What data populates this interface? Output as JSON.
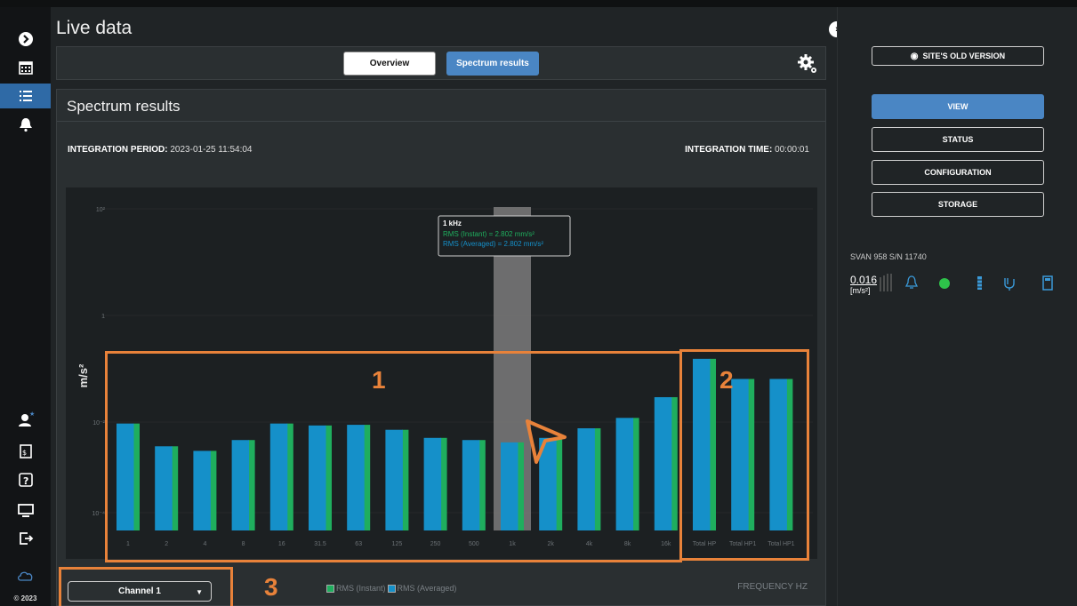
{
  "header": {
    "title": "Live data"
  },
  "tabs": [
    {
      "label": "Overview"
    },
    {
      "label": "Spectrum results"
    }
  ],
  "panel": {
    "title": "Spectrum results",
    "integration_period_label": "INTEGRATION PERIOD:",
    "integration_period_value": "2023-01-25 11:54:04",
    "integration_time_label": "INTEGRATION TIME:",
    "integration_time_value": "00:00:01"
  },
  "channel_select": {
    "value": "Channel 1"
  },
  "legend": {
    "instant": "RMS (Instant)",
    "averaged": "RMS (Averaged)"
  },
  "frequency_label": "FREQUENCY HZ",
  "annotations": [
    "1",
    "2",
    "3"
  ],
  "colors": {
    "accent": "#4a86c4",
    "instant": "#1fae5e",
    "averaged": "#1590c9",
    "annotation": "#e8823a"
  },
  "right_panel": {
    "old_version_label": "SITE'S OLD VERSION",
    "buttons": [
      "VIEW",
      "STATUS",
      "CONFIGURATION",
      "STORAGE"
    ],
    "device_name": "SVAN 958 S/N 11740",
    "device_value": "0.016",
    "device_unit": "[m/s²]"
  },
  "footer": {
    "copyright": "© 2023"
  },
  "chart_data": {
    "type": "bar",
    "ylabel": "m/s²",
    "xlabel": "FREQUENCY HZ",
    "yscale": "log",
    "ylim": [
      0.0001,
      10
    ],
    "y_ticks": [
      "10²",
      "1",
      "10⁻²",
      "10⁻⁴"
    ],
    "categories": [
      "1",
      "2",
      "4",
      "8",
      "16",
      "31.5",
      "63",
      "125",
      "250",
      "500",
      "1k",
      "2k",
      "4k",
      "8k",
      "16k",
      "Total HP",
      "Total HP1",
      "Total HP1"
    ],
    "series": [
      {
        "name": "RMS (Instant)",
        "values": [
          0.0045,
          0.002,
          0.0017,
          0.0025,
          0.0045,
          0.0042,
          0.0043,
          0.0036,
          0.0027,
          0.0025,
          0.0023,
          0.0027,
          0.0038,
          0.0055,
          0.0115,
          0.045,
          0.022,
          0.022
        ]
      },
      {
        "name": "RMS (Averaged)",
        "values": [
          0.0045,
          0.002,
          0.0017,
          0.0025,
          0.0045,
          0.0042,
          0.0043,
          0.0036,
          0.0027,
          0.0025,
          0.0023,
          0.0027,
          0.0038,
          0.0055,
          0.0115,
          0.045,
          0.022,
          0.022
        ]
      }
    ],
    "highlighted_category": "1k",
    "tooltip": {
      "title": "1 kHz",
      "instant": "RMS (Instant) = 2.802 mm/s²",
      "averaged": "RMS (Averaged) = 2.802 mm/s²"
    }
  }
}
